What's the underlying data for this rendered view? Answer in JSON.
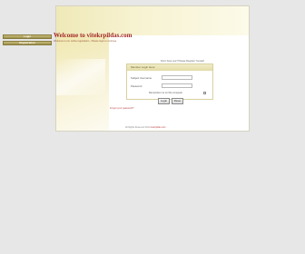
{
  "header": {
    "title": "Welcome to vitekrpildas.com",
    "subtitle": "Welcome to our online registration - Please login to continue"
  },
  "sidebar": {
    "items": [
      {
        "label": "Login"
      },
      {
        "label": "Registration"
      }
    ]
  },
  "login": {
    "hint": "Don't have one? Please Register Yourself",
    "box_title": "Member Login Here",
    "username_label": "Subject Username",
    "password_label": "Password",
    "username_value": "",
    "password_value": "",
    "remember_label": "Remember me on this computer",
    "login_button": "Login",
    "reset_button": "Reset"
  },
  "forgot_link": "Forgot your password?",
  "footer": {
    "text": "All Rights Reserved 2011",
    "link": "vitekrpildas.com"
  },
  "colors": {
    "page_background": "#e7e7e7",
    "accent": "#a22a28",
    "band": "#efe9b8"
  }
}
